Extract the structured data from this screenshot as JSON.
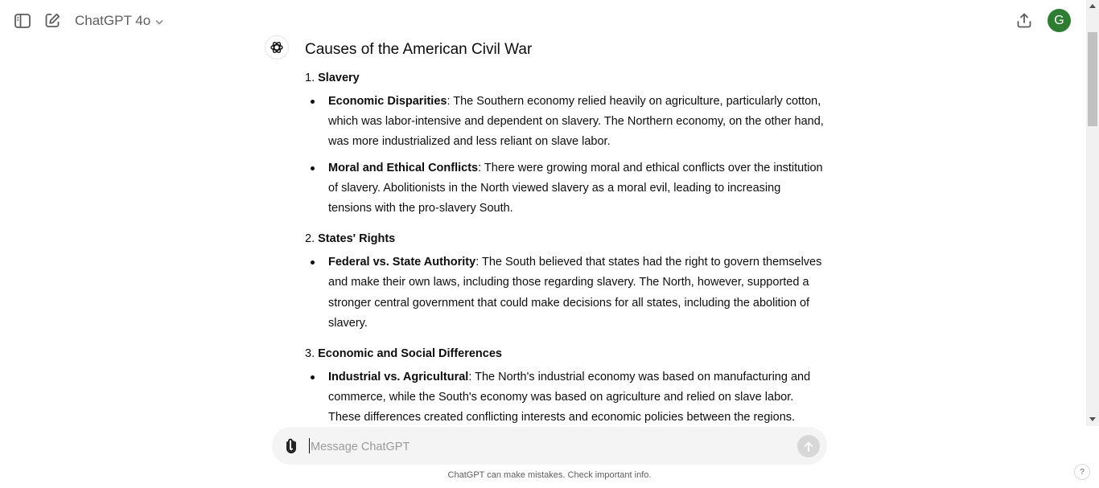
{
  "header": {
    "model_label": "ChatGPT 4o",
    "avatar_initial": "G"
  },
  "message": {
    "title": "Causes of the American Civil War",
    "sections": [
      {
        "number": "1.",
        "heading": "Slavery",
        "bullets": [
          {
            "term": "Economic Disparities",
            "text": ": The Southern economy relied heavily on agriculture, particularly cotton, which was labor-intensive and dependent on slavery. The Northern economy, on the other hand, was more industrialized and less reliant on slave labor."
          },
          {
            "term": "Moral and Ethical Conflicts",
            "text": ": There were growing moral and ethical conflicts over the institution of slavery. Abolitionists in the North viewed slavery as a moral evil, leading to increasing tensions with the pro-slavery South."
          }
        ]
      },
      {
        "number": "2.",
        "heading": "States' Rights",
        "bullets": [
          {
            "term": "Federal vs. State Authority",
            "text": ": The South believed that states had the right to govern themselves and make their own laws, including those regarding slavery. The North, however, supported a stronger central government that could make decisions for all states, including the abolition of slavery."
          }
        ]
      },
      {
        "number": "3.",
        "heading": "Economic and Social Differences",
        "bullets": [
          {
            "term": "Industrial vs. Agricultural",
            "text": ": The North's industrial economy was based on manufacturing and commerce, while the South's economy was based on agriculture and relied on slave labor. These differences created conflicting interests and economic policies between the regions."
          }
        ]
      }
    ]
  },
  "composer": {
    "placeholder": "Message ChatGPT"
  },
  "footer": {
    "disclaimer": "ChatGPT can make mistakes. Check important info.",
    "help_label": "?"
  },
  "colors": {
    "avatar_bg": "#2e7d32",
    "composer_bg": "#f4f4f4",
    "send_disabled": "#d7d7d7"
  }
}
